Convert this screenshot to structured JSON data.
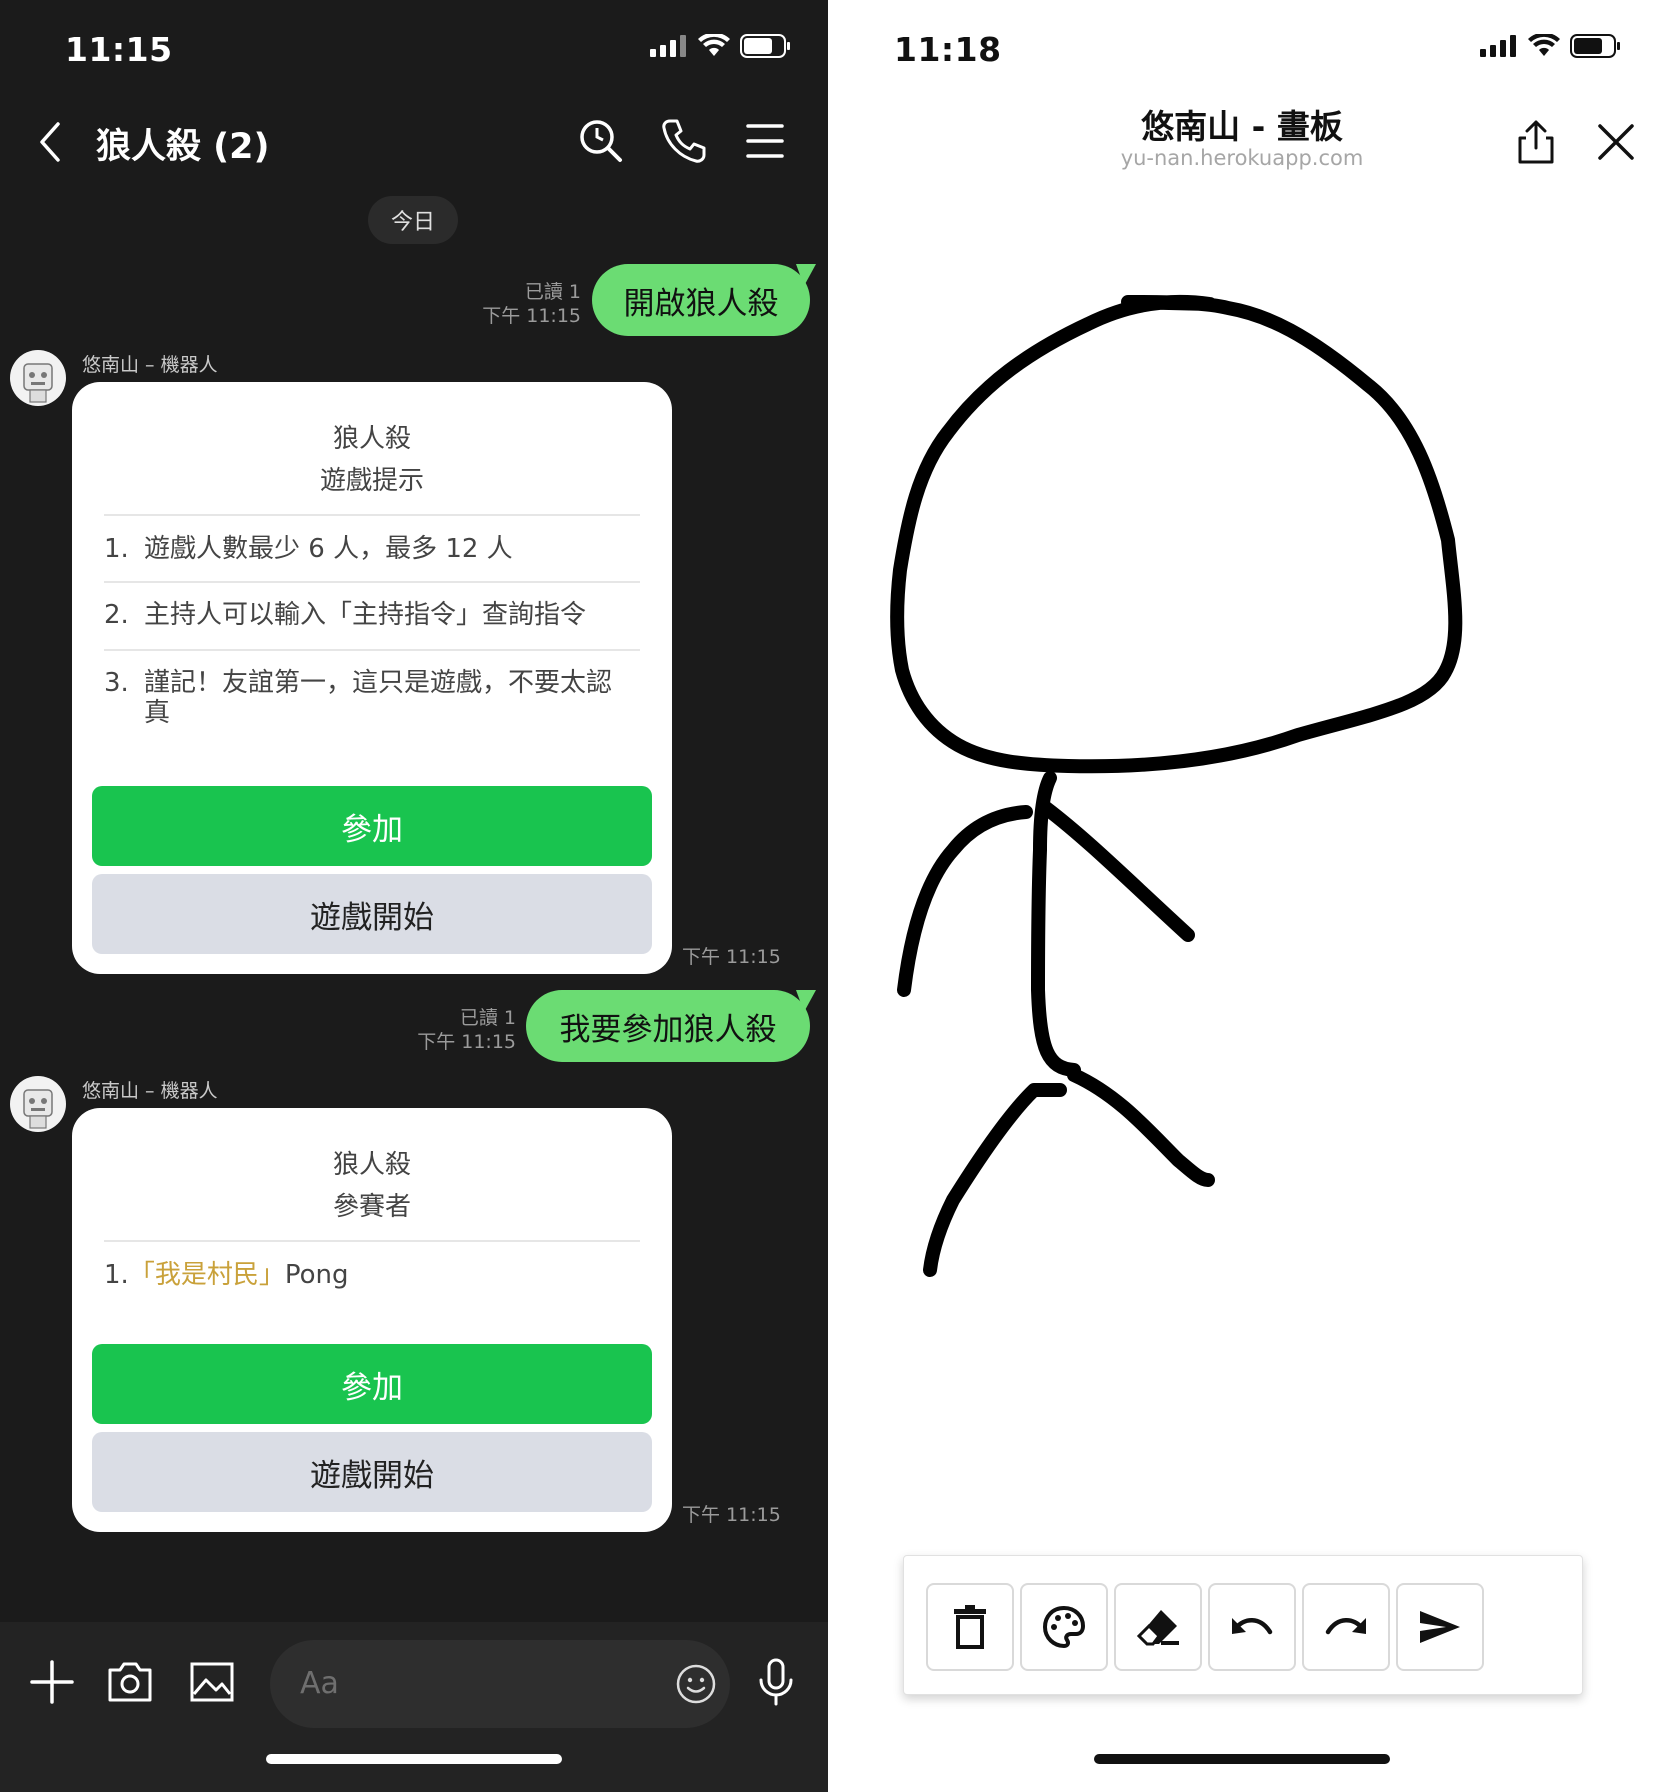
{
  "chat": {
    "status_time": "11:15",
    "title": "狼人殺 (2)",
    "date_label": "今日",
    "messages": [
      {
        "text": "開啟狼人殺",
        "read": "已讀 1",
        "time": "下午 11:15"
      },
      {
        "text": "我要參加狼人殺",
        "read": "已讀 1",
        "time": "下午 11:15"
      }
    ],
    "bot_name": "悠南山 – 機器人",
    "card1": {
      "title_line1": "狼人殺",
      "title_line2": "遊戲提示",
      "rules": [
        {
          "num": "1.",
          "text": "遊戲人數最少 6 人，最多 12 人"
        },
        {
          "num": "2.",
          "text": "主持人可以輸入「主持指令」查詢指令"
        },
        {
          "num": "3.",
          "text": "謹記！友誼第一，這只是遊戲，不要太認真"
        }
      ],
      "join_label": "參加",
      "start_label": "遊戲開始",
      "time": "下午 11:15"
    },
    "card2": {
      "title_line1": "狼人殺",
      "title_line2": "參賽者",
      "participant_num": "1.",
      "participant_role": "「我是村民」",
      "participant_name": "Pong",
      "join_label": "參加",
      "start_label": "遊戲開始",
      "time": "下午 11:15"
    },
    "input_placeholder": "Aa",
    "icons": [
      "chevron-left-icon",
      "search-icon",
      "phone-icon",
      "menu-icon",
      "plus-icon",
      "camera-icon",
      "image-icon",
      "emoji-icon",
      "microphone-icon"
    ]
  },
  "whiteboard": {
    "status_time": "11:18",
    "title": "悠南山 - 畫板",
    "url": "yu-nan.herokuapp.com",
    "tools": [
      "trash-icon",
      "palette-icon",
      "eraser-icon",
      "undo-icon",
      "redo-icon",
      "send-icon"
    ],
    "icons": [
      "share-icon",
      "close-icon"
    ]
  },
  "colors": {
    "chat_bg": "#1b1b1b",
    "my_bubble": "#6bdc73",
    "join_button": "#19c44f",
    "start_button": "#dadde5",
    "participant_role": "#c9a13a"
  }
}
